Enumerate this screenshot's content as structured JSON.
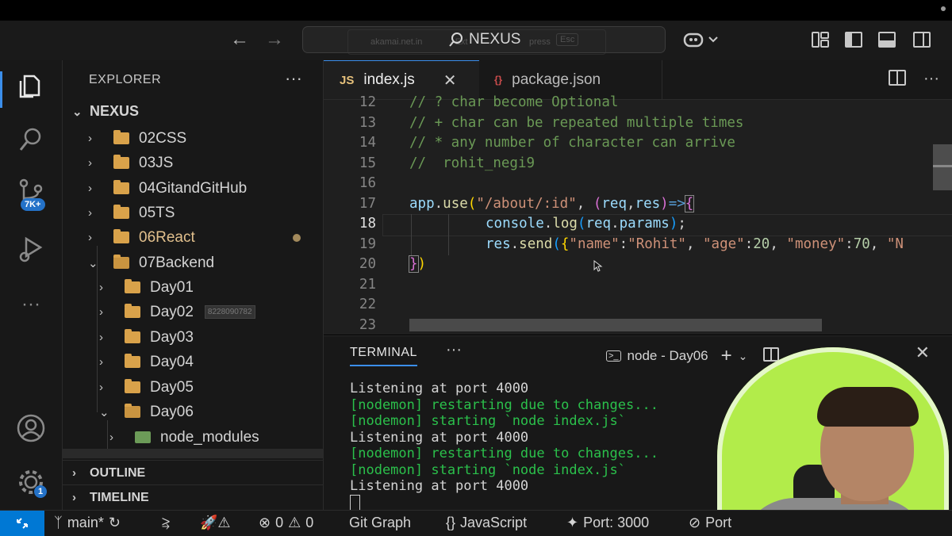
{
  "titlebar": {
    "search_label": "NEXUS",
    "ghost_text_a": "akamai.net.in",
    "ghost_text_b": "- Ext",
    "ghost_text_c": "press",
    "ghost_esc": "Esc"
  },
  "activity": {
    "source_control_badge": "7K+",
    "settings_badge": "1"
  },
  "sidebar": {
    "title": "EXPLORER",
    "more": "···",
    "root": "NEXUS",
    "items": [
      {
        "label": "02CSS"
      },
      {
        "label": "03JS"
      },
      {
        "label": "04GitandGitHub"
      },
      {
        "label": "05TS"
      },
      {
        "label": "06React"
      },
      {
        "label": "07Backend"
      },
      {
        "label": "Day01"
      },
      {
        "label": "Day02",
        "tag": "8228090782"
      },
      {
        "label": "Day03"
      },
      {
        "label": "Day04"
      },
      {
        "label": "Day05"
      },
      {
        "label": "Day06"
      },
      {
        "label": "node_modules"
      }
    ],
    "outline": "OUTLINE",
    "timeline": "TIMELINE"
  },
  "editor": {
    "tabs": [
      {
        "icon": "JS",
        "label": "index.js",
        "active": true
      },
      {
        "icon": "{}",
        "label": "package.json",
        "active": false
      }
    ],
    "lines": [
      {
        "n": "12",
        "text": "// ? char become Optional"
      },
      {
        "n": "13",
        "text": "// + char can be repeated multiple times"
      },
      {
        "n": "14",
        "text": "// * any number of character can arrive"
      },
      {
        "n": "15",
        "text": "//  rohit_negi9"
      },
      {
        "n": "16",
        "text": ""
      },
      {
        "n": "17",
        "text": "app.use(\"/about/:id\", (req,res)=>{"
      },
      {
        "n": "18",
        "text": "console.log(req.params);"
      },
      {
        "n": "19",
        "text": "res.send({\"name\":\"Rohit\", \"age\":20, \"money\":70, \"N"
      },
      {
        "n": "20",
        "text": "})"
      },
      {
        "n": "21",
        "text": ""
      },
      {
        "n": "22",
        "text": ""
      },
      {
        "n": "23",
        "text": ""
      }
    ],
    "code": {
      "app": "app",
      "use": "use",
      "path": "\"/about/:id\"",
      "req": "req",
      "res": "res",
      "console": "console",
      "log": "log",
      "params": "params",
      "send": "send",
      "k_name": "\"name\"",
      "v_name": "\"Rohit\"",
      "k_age": "\"age\"",
      "v_age": "20",
      "k_money": "\"money\"",
      "v_money": "70",
      "k_more": "\"N"
    }
  },
  "panel": {
    "tab": "TERMINAL",
    "more": "···",
    "terminal_name": "node - Day06",
    "lines": [
      {
        "text": "Listening at port 4000",
        "green": false
      },
      {
        "text": "[nodemon] restarting due to changes...",
        "green": true
      },
      {
        "text": "[nodemon] starting `node index.js`",
        "green": true
      },
      {
        "text": "Listening at port 4000",
        "green": false
      },
      {
        "text": "[nodemon] restarting due to changes...",
        "green": true
      },
      {
        "text": "[nodemon] starting `node index.js`",
        "green": true
      },
      {
        "text": "Listening at port 4000",
        "green": false
      }
    ]
  },
  "statusbar": {
    "branch": "main*",
    "errors": "0",
    "warnings": "0",
    "git_graph": "Git Graph",
    "language": "JavaScript",
    "port": "Port: 3000",
    "port_more": "Port"
  },
  "colors": {
    "accent": "#3b8eea",
    "remote": "#0078d4",
    "terminal_green": "#2bc04b",
    "webcam_bg": "#b2ec4a"
  }
}
